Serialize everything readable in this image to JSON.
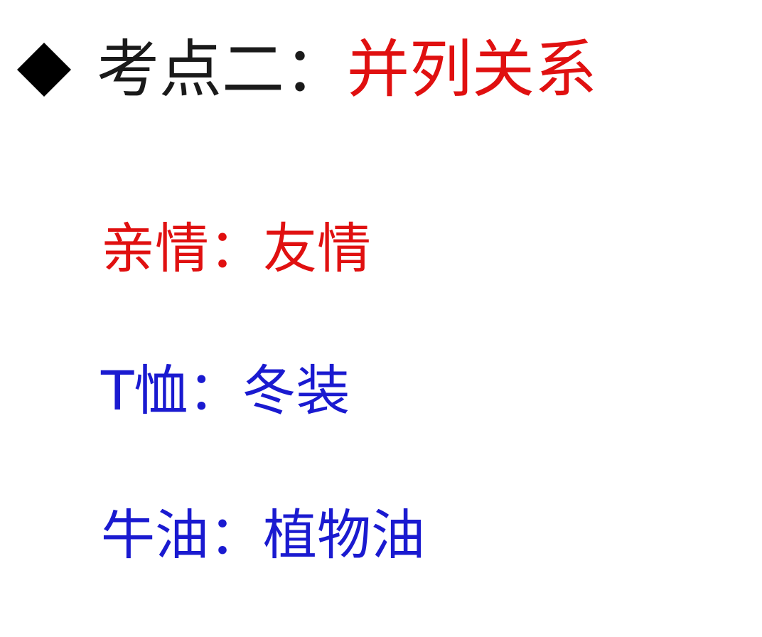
{
  "heading": {
    "bullet_icon": "black-diamond-icon",
    "prefix": "考点二：",
    "topic": "并列关系",
    "prefix_color": "#1a1a1a",
    "topic_color": "#e01010"
  },
  "pairs": [
    {
      "text": "亲情：友情",
      "color": "#e01010"
    },
    {
      "text": "T恤：冬装",
      "color": "#1a1ad0"
    },
    {
      "text": "牛油：植物油",
      "color": "#1a1ad0"
    }
  ]
}
